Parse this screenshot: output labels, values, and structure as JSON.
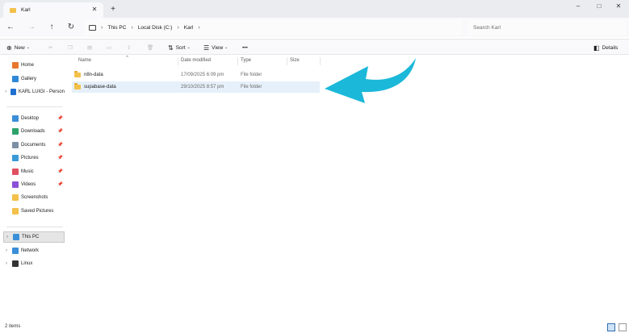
{
  "window": {
    "tab_title": "Karl",
    "tab_icon": "folder-icon",
    "new_tab": "+",
    "minimize": "–",
    "maximize": "□",
    "close": "✕"
  },
  "address": {
    "crumbs": [
      "This PC",
      "Local Disk (C:)",
      "Karl"
    ],
    "search_placeholder": "Search Karl"
  },
  "toolbar": {
    "new": "New",
    "sort": "Sort",
    "view": "View",
    "more": "•••",
    "details": "Details"
  },
  "sidebar": {
    "top": [
      {
        "label": "Home",
        "icon": "home-icon",
        "color": "#e8772e"
      },
      {
        "label": "Gallery",
        "icon": "gallery-icon",
        "color": "#2f88d8"
      },
      {
        "label": "KARL LUIGI - Person",
        "icon": "onedrive-icon",
        "color": "#1f6fd0"
      }
    ],
    "pinned": [
      {
        "label": "Desktop",
        "icon": "desktop-icon",
        "color": "#3b8fd8"
      },
      {
        "label": "Downloads",
        "icon": "download-icon",
        "color": "#2fa26b"
      },
      {
        "label": "Documents",
        "icon": "documents-icon",
        "color": "#7d8fa6"
      },
      {
        "label": "Pictures",
        "icon": "pictures-icon",
        "color": "#3b9ad8"
      },
      {
        "label": "Music",
        "icon": "music-icon",
        "color": "#e0505f"
      },
      {
        "label": "Videos",
        "icon": "videos-icon",
        "color": "#8b4fd8"
      },
      {
        "label": "Screenshots",
        "icon": "folder-icon",
        "color": "#f3c04a"
      },
      {
        "label": "Saved Pictures",
        "icon": "folder-icon",
        "color": "#f3c04a"
      }
    ],
    "devices": [
      {
        "label": "This PC",
        "icon": "pc-icon",
        "color": "#3b8fd8"
      },
      {
        "label": "Network",
        "icon": "network-icon",
        "color": "#3b8fd8"
      },
      {
        "label": "Linux",
        "icon": "linux-icon",
        "color": "#333333"
      }
    ]
  },
  "columns": [
    "Name",
    "Date modified",
    "Type",
    "Size"
  ],
  "files": [
    {
      "name": "n8n-data",
      "date": "17/09/2025 6:09 pm",
      "type": "File folder",
      "size": ""
    },
    {
      "name": "supabase-data",
      "date": "29/10/2025 8:57 pm",
      "type": "File folder",
      "size": ""
    }
  ],
  "status": {
    "count": "2 items"
  },
  "colors": {
    "arrow": "#1bb8d9",
    "selected_row": "#e6f0fa",
    "folder": "#f3c04a"
  }
}
